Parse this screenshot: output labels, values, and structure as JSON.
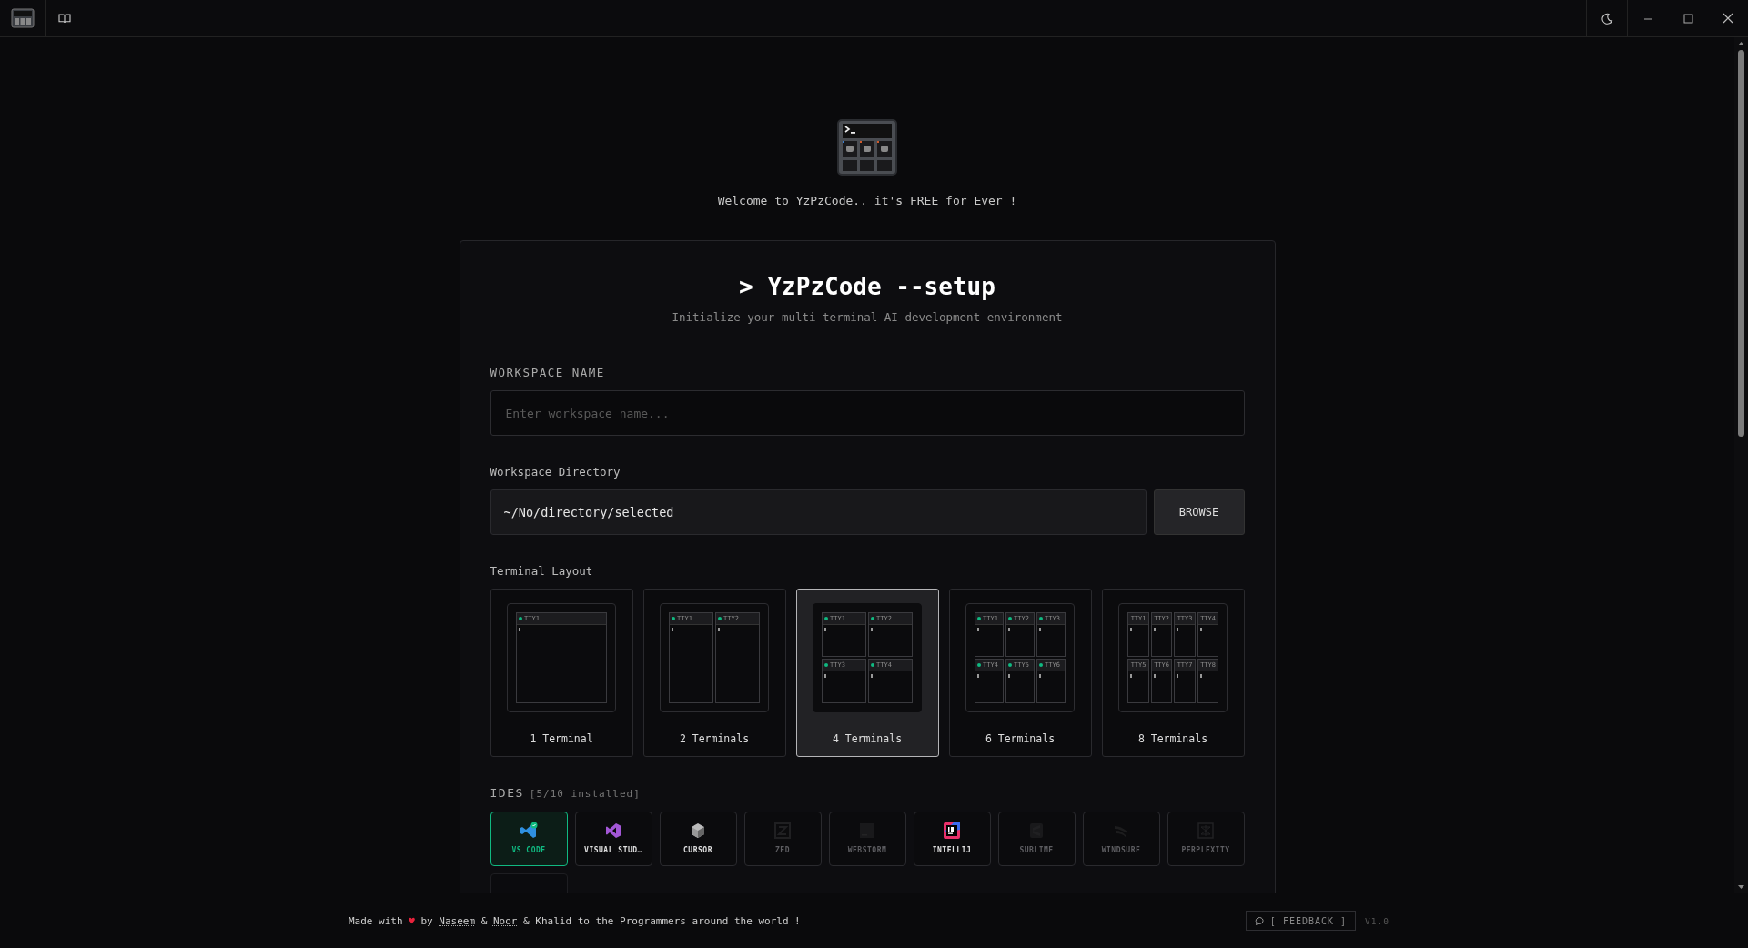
{
  "welcome": "Welcome to YzPzCode.. it's FREE for Ever !",
  "setup": {
    "prompt": ">",
    "title": "YzPzCode --setup",
    "subtitle": "Initialize your multi-terminal AI development environment",
    "workspace_name": {
      "label": "WORKSPACE NAME",
      "placeholder": "Enter workspace name..."
    },
    "directory": {
      "label": "Workspace Directory",
      "value": "~/No/directory/selected",
      "button": "BROWSE"
    },
    "layout_label": "Terminal Layout",
    "layouts": [
      {
        "label": "1 Terminal",
        "selected": false,
        "panes": [
          "TTY1"
        ],
        "status_dots": true
      },
      {
        "label": "2 Terminals",
        "selected": false,
        "panes": [
          "TTY1",
          "TTY2"
        ],
        "status_dots": true
      },
      {
        "label": "4 Terminals",
        "selected": true,
        "panes": [
          "TTY1",
          "TTY2",
          "TTY3",
          "TTY4"
        ],
        "status_dots": true
      },
      {
        "label": "6 Terminals",
        "selected": false,
        "panes": [
          "TTY1",
          "TTY2",
          "TTY3",
          "TTY4",
          "TTY5",
          "TTY6"
        ],
        "status_dots": true
      },
      {
        "label": "8 Terminals",
        "selected": false,
        "panes": [
          "TTY1",
          "TTY2",
          "TTY3",
          "TTY4",
          "TTY5",
          "TTY6",
          "TTY7",
          "TTY8"
        ],
        "status_dots": false
      }
    ],
    "ides_label": "IDES",
    "ides_count": "[5/10 installed]",
    "ides": [
      {
        "label": "VS CODE",
        "installed": true,
        "selected": true
      },
      {
        "label": "VISUAL STUD…",
        "installed": true,
        "selected": false
      },
      {
        "label": "CURSOR",
        "installed": true,
        "selected": false
      },
      {
        "label": "ZED",
        "installed": false,
        "selected": false
      },
      {
        "label": "WEBSTORM",
        "installed": false,
        "selected": false
      },
      {
        "label": "INTELLIJ",
        "installed": true,
        "selected": false
      },
      {
        "label": "SUBLIME",
        "installed": false,
        "selected": false
      },
      {
        "label": "WINDSURF",
        "installed": false,
        "selected": false
      },
      {
        "label": "PERPLEXITY",
        "installed": false,
        "selected": false
      },
      {
        "kind": "cut_off"
      }
    ]
  },
  "footer": {
    "credit": [
      {
        "text": "Made with "
      },
      {
        "text": "♥",
        "kind": "heart"
      },
      {
        "text": " by "
      },
      {
        "text": "Naseem",
        "kind": "link"
      },
      {
        "text": " & "
      },
      {
        "text": "Noor",
        "kind": "link"
      },
      {
        "text": " & Khalid to the Programmers around the world !"
      }
    ],
    "feedback": "[ FEEDBACK ]",
    "version": "V1.0"
  }
}
